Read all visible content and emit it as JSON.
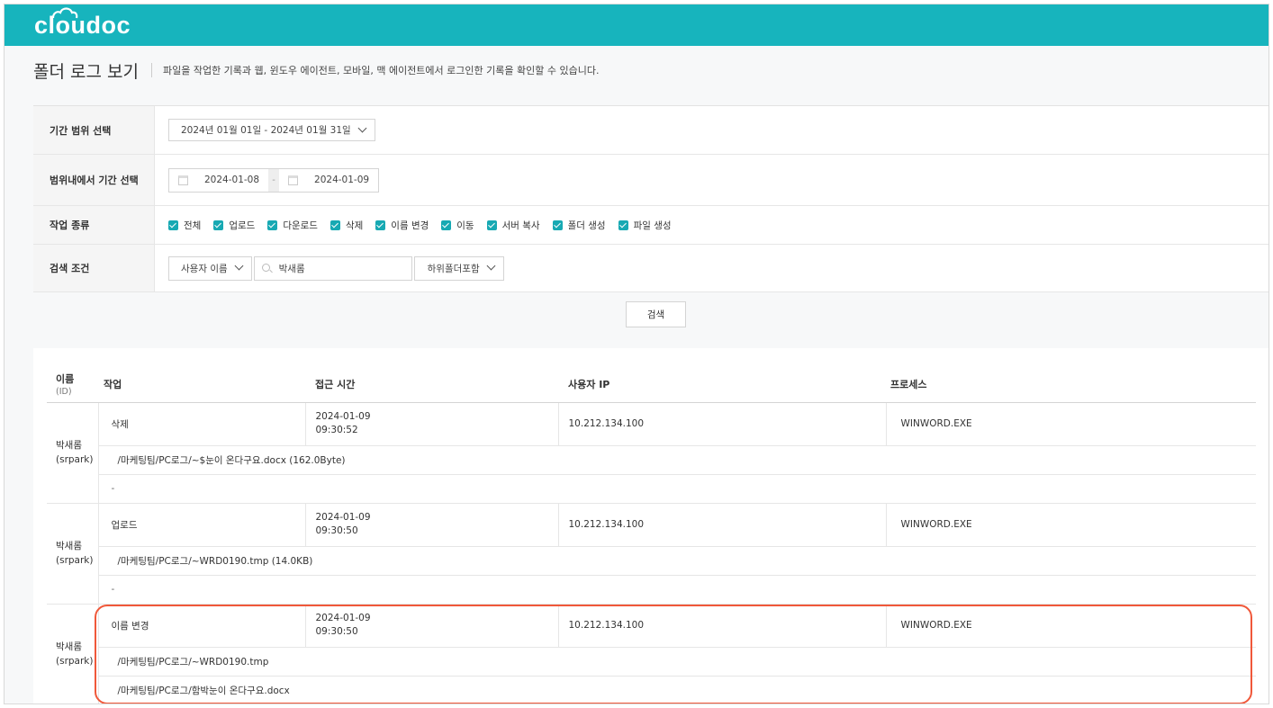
{
  "app": {
    "logo": "cloudoc",
    "accent": "#17b4bd",
    "highlight_color": "#f0583a"
  },
  "header": {
    "title": "폴더 로그 보기",
    "description": "파일을 작업한 기록과 웹, 윈도우 에이전트, 모바일, 맥 에이전트에서 로그인한 기록을 확인할 수 있습니다."
  },
  "filters": {
    "period_label": "기간 범위 선택",
    "period_value": "2024년 01월 01일 - 2024년 01월 31일",
    "date_label": "범위내에서 기간 선택",
    "date_from": "2024-01-08",
    "date_to": "2024-01-09",
    "date_sep": "-",
    "type_label": "작업 종류",
    "types": [
      {
        "label": "전체",
        "checked": true
      },
      {
        "label": "업로드",
        "checked": true
      },
      {
        "label": "다운로드",
        "checked": true
      },
      {
        "label": "삭제",
        "checked": true
      },
      {
        "label": "이름 변경",
        "checked": true
      },
      {
        "label": "이동",
        "checked": true
      },
      {
        "label": "서버 복사",
        "checked": true
      },
      {
        "label": "폴더 생성",
        "checked": true
      },
      {
        "label": "파일 생성",
        "checked": true
      }
    ],
    "condition_label": "검색 조건",
    "condition_field": "사용자 이름",
    "search_value": "박새롬",
    "scope": "하위폴더포함"
  },
  "search_button": "검색",
  "table": {
    "headers": {
      "name": "이름",
      "name_sub": "(ID)",
      "action": "작업",
      "time": "접근 시간",
      "ip": "사용자 IP",
      "process": "프로세스"
    },
    "rows": [
      {
        "name": "박새롬",
        "id": "(srpark)",
        "action": "삭제",
        "date": "2024-01-09",
        "time": "09:30:52",
        "ip": "10.212.134.100",
        "process": "WINWORD.EXE",
        "path": "/마케팅팀/PC로그/~$눈이 온다구요.docx (162.0Byte)",
        "path2": "-"
      },
      {
        "name": "박새롬",
        "id": "(srpark)",
        "action": "업로드",
        "date": "2024-01-09",
        "time": "09:30:50",
        "ip": "10.212.134.100",
        "process": "WINWORD.EXE",
        "path": "/마케팅팀/PC로그/~WRD0190.tmp (14.0KB)",
        "path2": "-"
      },
      {
        "name": "박새롬",
        "id": "(srpark)",
        "action": "이름 변경",
        "date": "2024-01-09",
        "time": "09:30:50",
        "ip": "10.212.134.100",
        "process": "WINWORD.EXE",
        "path": "/마케팅팀/PC로그/~WRD0190.tmp",
        "path2": "/마케팅팀/PC로그/함박눈이 온다구요.docx"
      }
    ]
  }
}
